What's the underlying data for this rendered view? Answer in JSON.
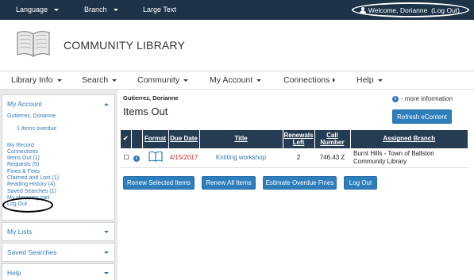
{
  "topbar": {
    "language": "Language",
    "branch": "Branch",
    "large_text": "Large Text",
    "welcome": "Welcome, Dorianne  (Log Out)"
  },
  "header": {
    "site_title": "COMMUNITY LIBRARY",
    "logo_icon": "open-book-icon"
  },
  "nav": {
    "items": [
      {
        "label": "Library Info"
      },
      {
        "label": "Search"
      },
      {
        "label": "Community"
      },
      {
        "label": "My Account"
      },
      {
        "label": "Connections"
      },
      {
        "label": "Help"
      }
    ]
  },
  "sidebar": {
    "my_account": {
      "title": "My Account",
      "name": "Gutierrez, Dorianne",
      "overdue": "1 Items overdue",
      "links": [
        "My Record",
        "Connections",
        "Items Out (1)",
        "Requests (5)",
        "Fines & Fees",
        "Claimed and Lost (1)",
        "Reading History (4)",
        "Saved Searches (1)",
        "My shopping cart",
        "Log Out"
      ]
    },
    "my_lists": "My Lists",
    "saved_searches": "Saved Searches",
    "help": "Help"
  },
  "main": {
    "patron_name": "Gutierrez, Dorianne",
    "page_title": "Items Out",
    "more_info": "- more information",
    "refresh_button": "Refresh eContent",
    "table": {
      "headers": {
        "check": "✔",
        "format": "Format",
        "due_date": "Due Date",
        "title": "Title",
        "renewals_left": "Renewals Left",
        "call_number": "Call Number",
        "assigned_branch": "Assigned Branch"
      },
      "rows": [
        {
          "format_icon": "book-icon",
          "due_date": "4/15/2017",
          "title": "Knitting workshop",
          "renewals_left": "2",
          "call_number": "746.43 Z",
          "assigned_branch": "Burnt Hills - Town of Ballston Community Library"
        }
      ]
    },
    "buttons": {
      "renew_selected": "Renew Selected Items",
      "renew_all": "Renew All Items",
      "estimate_fines": "Estimate Overdue Fines",
      "log_out": "Log Out"
    }
  },
  "colors": {
    "topbar_bg": "#1e3348",
    "link": "#337ab7",
    "button": "#2e7ebc",
    "table_header": "#263c53",
    "overdue_date": "#c9302c"
  }
}
